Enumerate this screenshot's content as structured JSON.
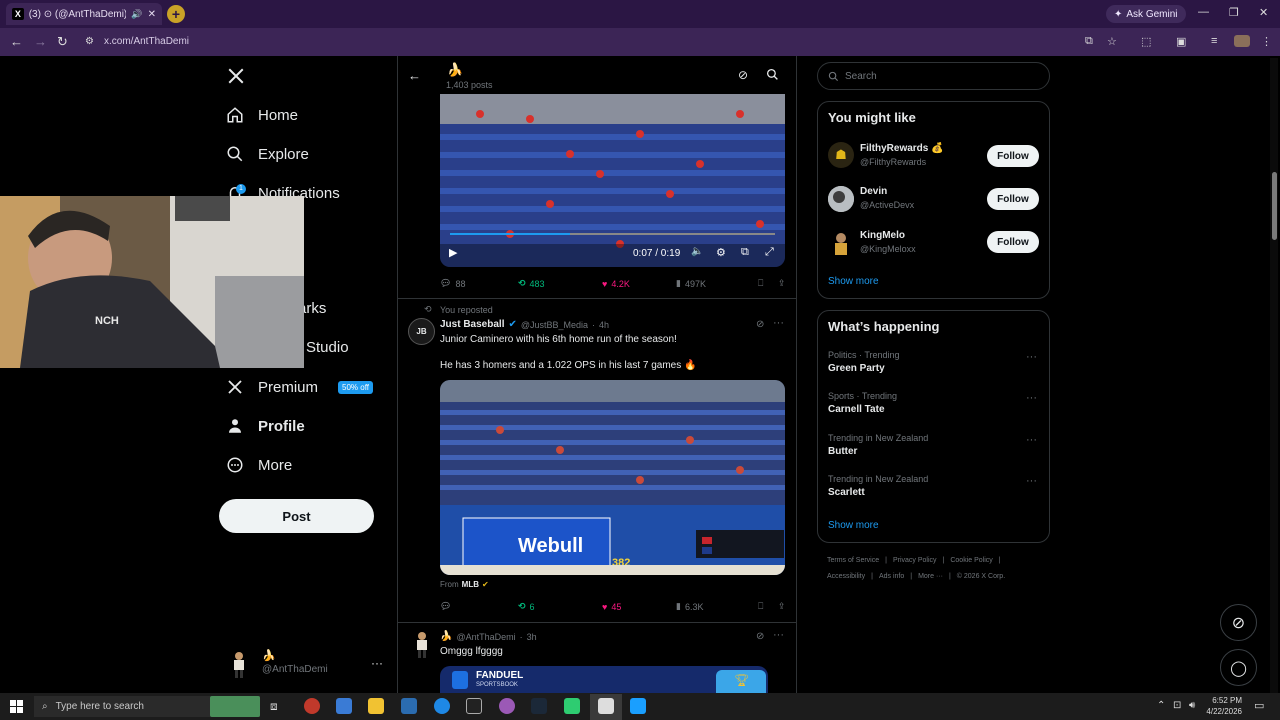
{
  "browser": {
    "tab_title": "(3) ⊙ (@AntThaDemi) / X",
    "new_tab_icon": "plus-icon",
    "ask_gemini": "Ask Gemini",
    "url": "x.com/AntThaDemi"
  },
  "nav": {
    "items": [
      {
        "label": "Home",
        "icon": "home-icon"
      },
      {
        "label": "Explore",
        "icon": "search-icon"
      },
      {
        "label": "Notifications",
        "icon": "bell-icon"
      },
      {
        "label": "arks",
        "icon": "bookmark-icon"
      },
      {
        "label": "Studio",
        "icon": "studio-icon"
      },
      {
        "label": "Premium",
        "icon": "x-logo-icon"
      },
      {
        "label": "Profile",
        "icon": "person-icon"
      },
      {
        "label": "More",
        "icon": "more-circle-icon"
      }
    ],
    "premium_badge": "50% off",
    "post_button": "Post",
    "notification_count": "1",
    "account_emoji": "🍌",
    "account_handle": "@AntThaDemi"
  },
  "profile_header": {
    "name_emoji": "🍌",
    "post_count": "1,403 posts"
  },
  "tweets": [
    {
      "video_time": "0:07 / 0:19",
      "replies": "88",
      "reposts": "483",
      "likes": "4.2K",
      "views": "497K"
    },
    {
      "repost_label": "You reposted",
      "author": "Just Baseball",
      "handle": "@JustBB_Media",
      "time": "4h",
      "avatar_text": "JB",
      "text_line1": "Junior Caminero with his 6th home run of the season!",
      "text_line2": "He has 3 homers and a 1.022 OPS in his last 7 games 🔥",
      "from_label": "From",
      "from_source": "MLB",
      "replies": "",
      "reposts": "6",
      "likes": "45",
      "views": "6.3K",
      "media_text": "Webull",
      "scoreboard_number": "382"
    },
    {
      "author_emoji": "🍌",
      "handle": "@AntThaDemi",
      "time": "3h",
      "text": "Omggg lfgggg",
      "media_brand": "FANDUEL",
      "media_sub": "SPORTSBOOK"
    }
  ],
  "sidebar": {
    "search_placeholder": "Search",
    "you_might_like": {
      "title": "You might like",
      "users": [
        {
          "name": "FilthyRewards 💰",
          "handle": "@FilthyRewards",
          "button": "Follow"
        },
        {
          "name": "Devin",
          "handle": "@ActiveDevx",
          "button": "Follow"
        },
        {
          "name": "KingMelo",
          "handle": "@KingMeloxx",
          "button": "Follow"
        }
      ],
      "show_more": "Show more"
    },
    "whats_happening": {
      "title": "What’s happening",
      "trends": [
        {
          "context": "Politics · Trending",
          "name": "Green Party"
        },
        {
          "context": "Sports · Trending",
          "name": "Carnell Tate"
        },
        {
          "context": "Trending in New Zealand",
          "name": "Butter"
        },
        {
          "context": "Trending in New Zealand",
          "name": "Scarlett"
        }
      ],
      "show_more": "Show more"
    },
    "footer": {
      "line1": [
        "Terms of Service",
        "Privacy Policy",
        "Cookie Policy"
      ],
      "line2": [
        "Accessibility",
        "Ads info",
        "More ···",
        "© 2026 X Corp."
      ]
    }
  },
  "taskbar": {
    "search_placeholder": "Type here to search",
    "time": "6:52 PM",
    "date": "4/22/2026"
  },
  "colors": {
    "accent": "#1d9bf0",
    "like": "#f91880",
    "repost": "#00ba7c",
    "browser_chrome": "#3c2556"
  }
}
